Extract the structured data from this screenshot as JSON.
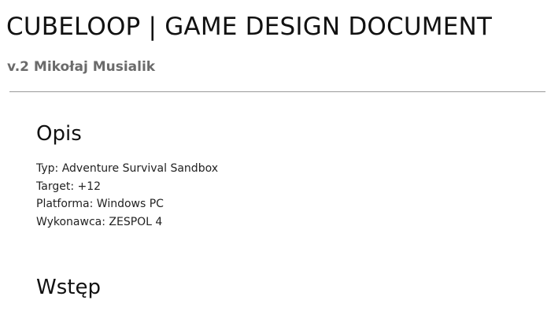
{
  "document": {
    "title": "CUBELOOP | GAME DESIGN DOCUMENT",
    "subtitle": "v.2 Mikołaj Musialik"
  },
  "sections": [
    {
      "heading": "Opis",
      "lines": [
        "Typ: Adventure Survival Sandbox",
        "Target: +12",
        "Platforma: Windows PC",
        "Wykonawca: ZESPOL 4"
      ]
    },
    {
      "heading": "Wstęp"
    }
  ],
  "colors": {
    "title": "#111111",
    "subtitle": "#6b6b6b",
    "divider": "#9a9a9a",
    "body_text": "#222222",
    "background": "#ffffff"
  }
}
